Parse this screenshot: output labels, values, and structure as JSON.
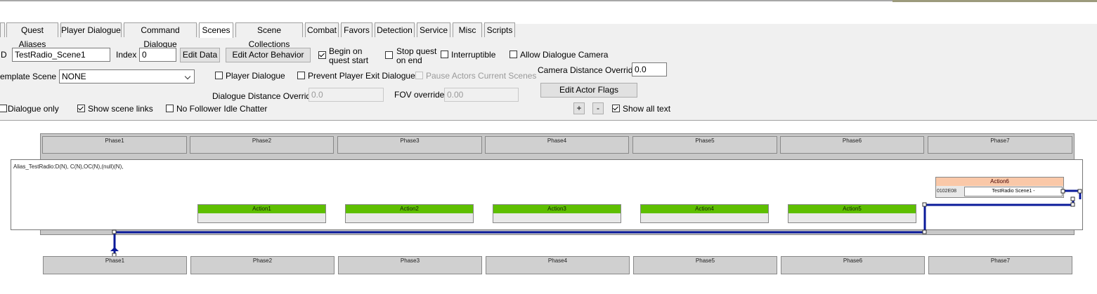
{
  "tabs": [
    {
      "label": "Quest Aliases",
      "active": false
    },
    {
      "label": "Player Dialogue",
      "active": false
    },
    {
      "label": "Command Dialogue",
      "active": false
    },
    {
      "label": "Scenes",
      "active": true
    },
    {
      "label": "Scene Collections",
      "active": false
    },
    {
      "label": "Combat",
      "active": false
    },
    {
      "label": "Favors",
      "active": false
    },
    {
      "label": "Detection",
      "active": false
    },
    {
      "label": "Service",
      "active": false
    },
    {
      "label": "Misc",
      "active": false
    },
    {
      "label": "Scripts",
      "active": false
    }
  ],
  "form": {
    "id_label": "D",
    "id_value": "TestRadio_Scene1",
    "index_label": "Index",
    "index_value": "0",
    "edit_data": "Edit Data",
    "edit_actor_behavior": "Edit Actor Behavior",
    "begin_on_quest_start": "Begin on quest start",
    "stop_quest_on_end": "Stop quest on end",
    "interruptible": "Interruptible",
    "allow_dialogue_camera": "Allow Dialogue Camera",
    "template_scene_label": "emplate Scene",
    "template_scene_value": "NONE",
    "player_dialogue": "Player Dialogue",
    "prevent_player_exit": "Prevent Player Exit Dialogue",
    "pause_actors": "Pause Actors Current Scenes",
    "camera_distance_label": "Camera Distance Override",
    "camera_distance_value": "0.0",
    "edit_actor_flags": "Edit Actor Flags",
    "dialogue_distance_label": "Dialogue Distance Override",
    "dialogue_distance_value": "0.0",
    "fov_label": "FOV override",
    "fov_value": "0.00",
    "dialogue_only": "Dialogue only",
    "show_scene_links": "Show scene links",
    "no_follower_idle": "No Follower Idle Chatter",
    "plus": "+",
    "minus": "-",
    "show_all_text": "Show all text"
  },
  "checks": {
    "begin_on_quest_start": true,
    "stop_quest_on_end": false,
    "interruptible": false,
    "allow_dialogue_camera": false,
    "player_dialogue": false,
    "prevent_player_exit": false,
    "pause_actors": false,
    "dialogue_only": false,
    "show_scene_links": true,
    "no_follower_idle": false,
    "show_all_text": true
  },
  "scene": {
    "phases_top": [
      "Phase1",
      "Phase2",
      "Phase3",
      "Phase4",
      "Phase5",
      "Phase6",
      "Phase7"
    ],
    "phases_bottom": [
      "Phase1",
      "Phase2",
      "Phase3",
      "Phase4",
      "Phase5",
      "Phase6",
      "Phase7"
    ],
    "alias_text": "Alias_TestRadio:D(N), C(N),OC(N),(null)(N),",
    "actions": [
      "Action1",
      "Action2",
      "Action3",
      "Action4",
      "Action5"
    ],
    "action6": {
      "label": "Action6",
      "id": "0102E08",
      "text": "TestRadio Scene1 -"
    },
    "link_color": "#0a1a9a"
  }
}
